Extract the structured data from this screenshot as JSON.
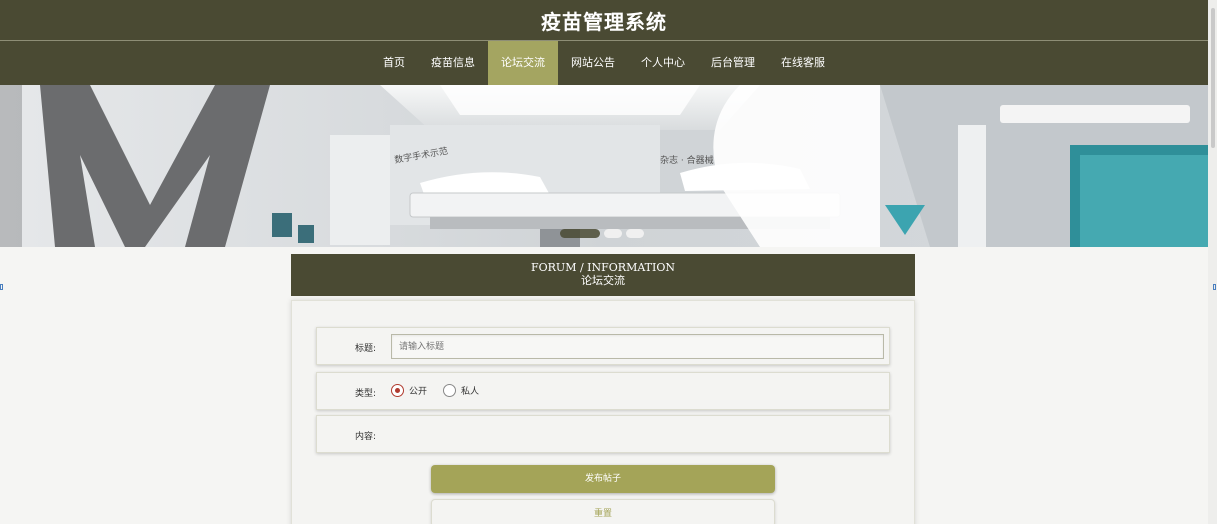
{
  "site": {
    "title": "疫苗管理系统"
  },
  "nav": {
    "items": [
      {
        "label": "首页",
        "active": false
      },
      {
        "label": "疫苗信息",
        "active": false
      },
      {
        "label": "论坛交流",
        "active": true
      },
      {
        "label": "网站公告",
        "active": false
      },
      {
        "label": "个人中心",
        "active": false
      },
      {
        "label": "后台管理",
        "active": false
      },
      {
        "label": "在线客服",
        "active": false
      }
    ]
  },
  "banner": {
    "slides": 3,
    "active_slide": 1
  },
  "section": {
    "title_en": "FORUM / INFORMATION",
    "title_cn": "论坛交流"
  },
  "form": {
    "title_label": "标题:",
    "title_value": "",
    "title_placeholder": "请输入标题",
    "type_label": "类型:",
    "type_options": [
      {
        "label": "公开",
        "checked": true
      },
      {
        "label": "私人",
        "checked": false
      }
    ],
    "content_label": "内容:",
    "submit_label": "发布帖子",
    "reset_label": "重置"
  },
  "colors": {
    "header_bg": "#4a4a33",
    "accent": "#a4a561",
    "radio_checked": "#b03a2e"
  }
}
